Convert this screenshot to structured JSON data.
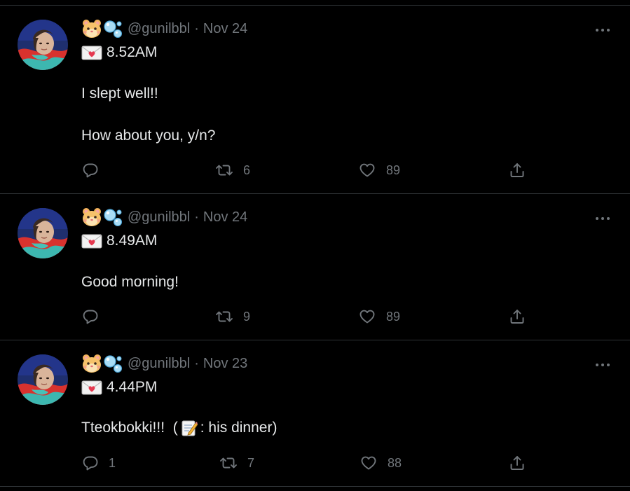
{
  "colors": {
    "background": "#000000",
    "text": "#e7e9ea",
    "muted": "#71767b",
    "divider": "#2f3336"
  },
  "tweets": [
    {
      "handle": "@gunilbbl",
      "separator": "·",
      "date": "Nov 24",
      "time": "8.52AM",
      "lines": [
        "I slept well!!",
        "How about you, y/n?"
      ],
      "replies": "",
      "retweets": "6",
      "likes": "89",
      "icons": [
        "hamster-face-icon",
        "bubbles-icon",
        "love-letter-icon",
        "reply-icon",
        "retweet-icon",
        "like-icon",
        "share-icon",
        "more-icon"
      ]
    },
    {
      "handle": "@gunilbbl",
      "separator": "·",
      "date": "Nov 24",
      "time": "8.49AM",
      "lines": [
        "Good morning!"
      ],
      "replies": "",
      "retweets": "9",
      "likes": "89",
      "icons": [
        "hamster-face-icon",
        "bubbles-icon",
        "love-letter-icon",
        "reply-icon",
        "retweet-icon",
        "like-icon",
        "share-icon",
        "more-icon"
      ]
    },
    {
      "handle": "@gunilbbl",
      "separator": "·",
      "date": "Nov 23",
      "time": "4.44PM",
      "text_before": "Tteokbokki!!!  (",
      "text_after": ": his dinner)",
      "replies": "1",
      "retweets": "7",
      "likes": "88",
      "icons": [
        "hamster-face-icon",
        "bubbles-icon",
        "love-letter-icon",
        "memo-icon",
        "reply-icon",
        "retweet-icon",
        "like-icon",
        "share-icon",
        "more-icon"
      ]
    }
  ]
}
